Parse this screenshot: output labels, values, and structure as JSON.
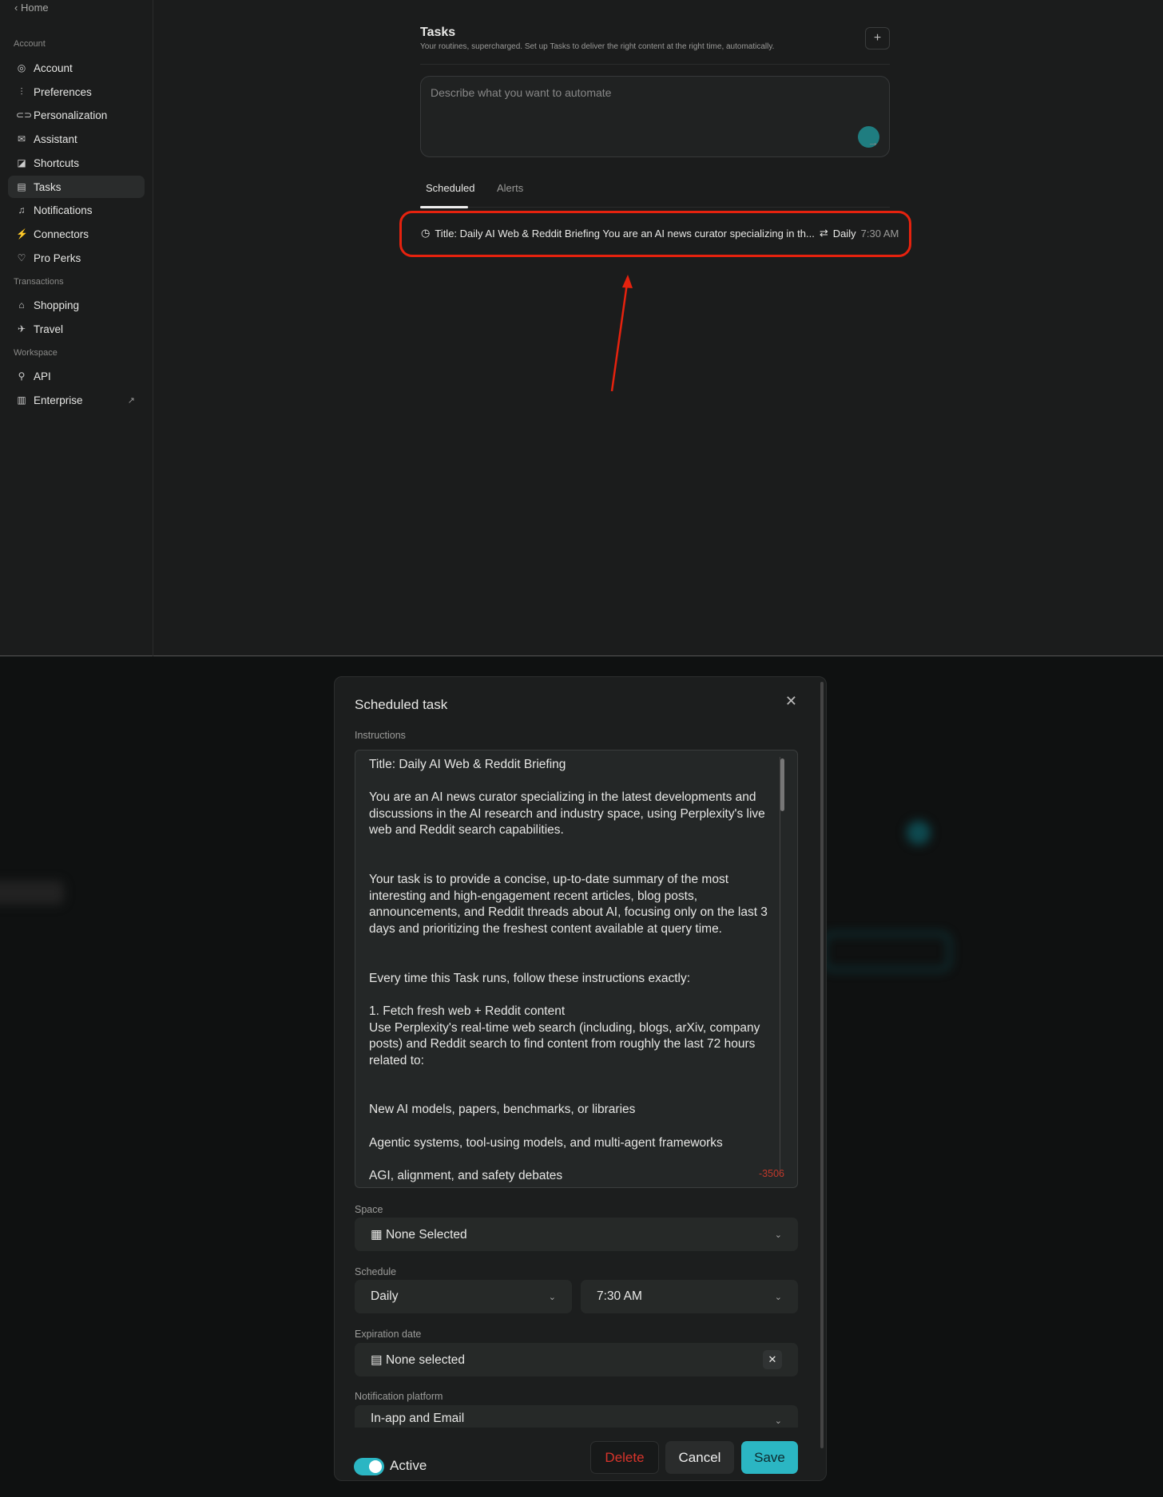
{
  "sidebar": {
    "home": "Home",
    "sections": {
      "account": "Account",
      "transactions": "Transactions",
      "workspace": "Workspace"
    },
    "items": [
      {
        "label": "Account"
      },
      {
        "label": "Preferences"
      },
      {
        "label": "Personalization"
      },
      {
        "label": "Assistant"
      },
      {
        "label": "Shortcuts"
      },
      {
        "label": "Tasks"
      },
      {
        "label": "Notifications"
      },
      {
        "label": "Connectors"
      },
      {
        "label": "Pro Perks"
      },
      {
        "label": "Shopping"
      },
      {
        "label": "Travel"
      },
      {
        "label": "API"
      },
      {
        "label": "Enterprise"
      }
    ]
  },
  "tasks": {
    "title": "Tasks",
    "subtitle": "Your routines, supercharged. Set up Tasks to deliver the right content at the right time, automatically.",
    "placeholder": "Describe what you want to automate",
    "tabs": [
      "Scheduled",
      "Alerts"
    ],
    "row": {
      "text": "Title: Daily AI Web & Reddit Briefing You are an AI news curator specializing in th...",
      "freq": "Daily",
      "time": "7:30 AM"
    }
  },
  "modal": {
    "title": "Scheduled task",
    "instructions_label": "Instructions",
    "instructions": "Title: Daily AI Web & Reddit Briefing\n\nYou are an AI news curator specializing in the latest developments and discussions in the AI research and industry space, using Perplexity's live web and Reddit search capabilities.\n\n\nYour task is to provide a concise, up-to-date summary of the most interesting and high-engagement recent articles, blog posts, announcements, and Reddit threads about AI, focusing only on the last 3 days and prioritizing the freshest content available at query time.\n\n\nEvery time this Task runs, follow these instructions exactly:\n\n1. Fetch fresh web + Reddit content\nUse Perplexity's real-time web search (including, blogs, arXiv, company posts) and Reddit search to find content from roughly the last 72 hours related to:\n\n\nNew AI models, papers, benchmarks, or libraries\n\nAgentic systems, tool-using models, and multi-agent frameworks\n\nAGI, alignment, and safety debates",
    "char_count": "-3506",
    "space_label": "Space",
    "space_value": "None Selected",
    "schedule_label": "Schedule",
    "schedule_freq": "Daily",
    "schedule_time": "7:30 AM",
    "expiration_label": "Expiration date",
    "expiration_value": "None selected",
    "notification_label": "Notification platform",
    "notification_value": "In-app and Email",
    "active_label": "Active",
    "active": true,
    "delete": "Delete",
    "cancel": "Cancel",
    "save": "Save"
  },
  "colors": {
    "accent": "#2bb6c3",
    "danger": "#d9342b",
    "highlight": "#e6220e"
  }
}
